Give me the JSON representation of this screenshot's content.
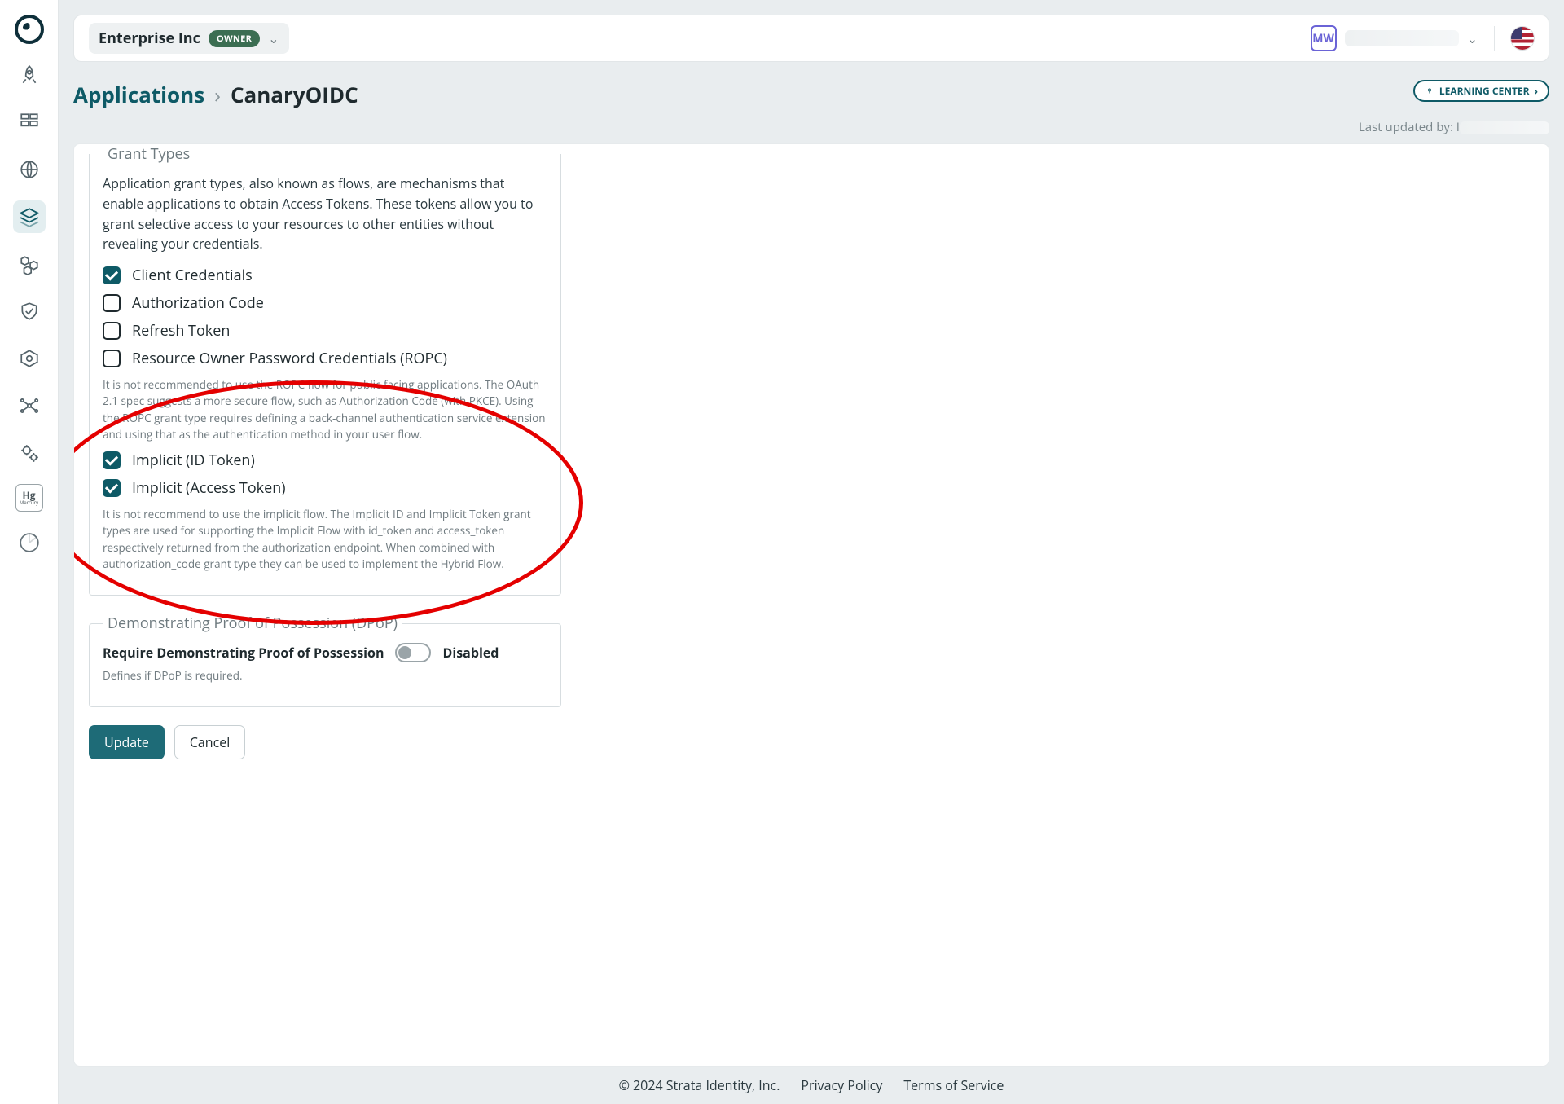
{
  "header": {
    "org_name": "Enterprise Inc",
    "owner_badge": "OWNER",
    "avatar_initials": "MW"
  },
  "breadcrumb": {
    "root": "Applications",
    "current": "CanaryOIDC",
    "learning_center": "LEARNING CENTER"
  },
  "updated_prefix": "Last updated by: ",
  "grant_types": {
    "legend": "Grant Types",
    "description": "Application grant types, also known as flows, are mechanisms that enable applications to obtain Access Tokens. These tokens allow you to grant selective access to your resources to other entities without revealing your credentials.",
    "items": [
      {
        "label": "Client Credentials",
        "checked": true
      },
      {
        "label": "Authorization Code",
        "checked": false
      },
      {
        "label": "Refresh Token",
        "checked": false
      },
      {
        "label": "Resource Owner Password Credentials (ROPC)",
        "checked": false
      }
    ],
    "ropc_note": "It is not recommended to use the ROPC flow for public facing applications. The OAuth 2.1 spec suggests a more secure flow, such as Authorization Code (with PKCE). Using the ROPC grant type requires defining a back-channel authentication service extension and using that as the authentication method in your user flow.",
    "implicit": [
      {
        "label": "Implicit (ID Token)",
        "checked": true
      },
      {
        "label": "Implicit (Access Token)",
        "checked": true
      }
    ],
    "implicit_note": "It is not recommend to use the implicit flow. The Implicit ID and Implicit Token grant types are used for supporting the Implicit Flow with id_token and access_token respectively returned from the authorization endpoint. When combined with authorization_code grant type they can be used to implement the Hybrid Flow."
  },
  "dpop": {
    "legend": "Demonstrating Proof of Possession (DPoP)",
    "toggle_label": "Require Demonstrating Proof of Possession",
    "state": "Disabled",
    "note": "Defines if DPoP is required."
  },
  "buttons": {
    "update": "Update",
    "cancel": "Cancel"
  },
  "footer": {
    "copyright": "© 2024 Strata Identity, Inc.",
    "privacy": "Privacy Policy",
    "terms": "Terms of Service"
  },
  "sidebar_icons": [
    "rocket",
    "dashboard",
    "globe",
    "layers",
    "hexagons",
    "shield",
    "target",
    "network",
    "gears",
    "hg",
    "radar"
  ],
  "sidebar_active_index": 3
}
